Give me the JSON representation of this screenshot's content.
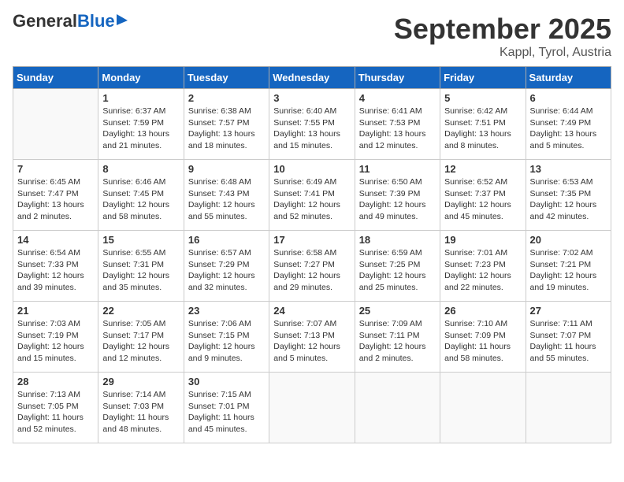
{
  "header": {
    "logo_general": "General",
    "logo_blue": "Blue",
    "month": "September 2025",
    "location": "Kappl, Tyrol, Austria"
  },
  "days_of_week": [
    "Sunday",
    "Monday",
    "Tuesday",
    "Wednesday",
    "Thursday",
    "Friday",
    "Saturday"
  ],
  "weeks": [
    [
      {
        "day": "",
        "sunrise": "",
        "sunset": "",
        "daylight": ""
      },
      {
        "day": "1",
        "sunrise": "Sunrise: 6:37 AM",
        "sunset": "Sunset: 7:59 PM",
        "daylight": "Daylight: 13 hours and 21 minutes."
      },
      {
        "day": "2",
        "sunrise": "Sunrise: 6:38 AM",
        "sunset": "Sunset: 7:57 PM",
        "daylight": "Daylight: 13 hours and 18 minutes."
      },
      {
        "day": "3",
        "sunrise": "Sunrise: 6:40 AM",
        "sunset": "Sunset: 7:55 PM",
        "daylight": "Daylight: 13 hours and 15 minutes."
      },
      {
        "day": "4",
        "sunrise": "Sunrise: 6:41 AM",
        "sunset": "Sunset: 7:53 PM",
        "daylight": "Daylight: 13 hours and 12 minutes."
      },
      {
        "day": "5",
        "sunrise": "Sunrise: 6:42 AM",
        "sunset": "Sunset: 7:51 PM",
        "daylight": "Daylight: 13 hours and 8 minutes."
      },
      {
        "day": "6",
        "sunrise": "Sunrise: 6:44 AM",
        "sunset": "Sunset: 7:49 PM",
        "daylight": "Daylight: 13 hours and 5 minutes."
      }
    ],
    [
      {
        "day": "7",
        "sunrise": "Sunrise: 6:45 AM",
        "sunset": "Sunset: 7:47 PM",
        "daylight": "Daylight: 13 hours and 2 minutes."
      },
      {
        "day": "8",
        "sunrise": "Sunrise: 6:46 AM",
        "sunset": "Sunset: 7:45 PM",
        "daylight": "Daylight: 12 hours and 58 minutes."
      },
      {
        "day": "9",
        "sunrise": "Sunrise: 6:48 AM",
        "sunset": "Sunset: 7:43 PM",
        "daylight": "Daylight: 12 hours and 55 minutes."
      },
      {
        "day": "10",
        "sunrise": "Sunrise: 6:49 AM",
        "sunset": "Sunset: 7:41 PM",
        "daylight": "Daylight: 12 hours and 52 minutes."
      },
      {
        "day": "11",
        "sunrise": "Sunrise: 6:50 AM",
        "sunset": "Sunset: 7:39 PM",
        "daylight": "Daylight: 12 hours and 49 minutes."
      },
      {
        "day": "12",
        "sunrise": "Sunrise: 6:52 AM",
        "sunset": "Sunset: 7:37 PM",
        "daylight": "Daylight: 12 hours and 45 minutes."
      },
      {
        "day": "13",
        "sunrise": "Sunrise: 6:53 AM",
        "sunset": "Sunset: 7:35 PM",
        "daylight": "Daylight: 12 hours and 42 minutes."
      }
    ],
    [
      {
        "day": "14",
        "sunrise": "Sunrise: 6:54 AM",
        "sunset": "Sunset: 7:33 PM",
        "daylight": "Daylight: 12 hours and 39 minutes."
      },
      {
        "day": "15",
        "sunrise": "Sunrise: 6:55 AM",
        "sunset": "Sunset: 7:31 PM",
        "daylight": "Daylight: 12 hours and 35 minutes."
      },
      {
        "day": "16",
        "sunrise": "Sunrise: 6:57 AM",
        "sunset": "Sunset: 7:29 PM",
        "daylight": "Daylight: 12 hours and 32 minutes."
      },
      {
        "day": "17",
        "sunrise": "Sunrise: 6:58 AM",
        "sunset": "Sunset: 7:27 PM",
        "daylight": "Daylight: 12 hours and 29 minutes."
      },
      {
        "day": "18",
        "sunrise": "Sunrise: 6:59 AM",
        "sunset": "Sunset: 7:25 PM",
        "daylight": "Daylight: 12 hours and 25 minutes."
      },
      {
        "day": "19",
        "sunrise": "Sunrise: 7:01 AM",
        "sunset": "Sunset: 7:23 PM",
        "daylight": "Daylight: 12 hours and 22 minutes."
      },
      {
        "day": "20",
        "sunrise": "Sunrise: 7:02 AM",
        "sunset": "Sunset: 7:21 PM",
        "daylight": "Daylight: 12 hours and 19 minutes."
      }
    ],
    [
      {
        "day": "21",
        "sunrise": "Sunrise: 7:03 AM",
        "sunset": "Sunset: 7:19 PM",
        "daylight": "Daylight: 12 hours and 15 minutes."
      },
      {
        "day": "22",
        "sunrise": "Sunrise: 7:05 AM",
        "sunset": "Sunset: 7:17 PM",
        "daylight": "Daylight: 12 hours and 12 minutes."
      },
      {
        "day": "23",
        "sunrise": "Sunrise: 7:06 AM",
        "sunset": "Sunset: 7:15 PM",
        "daylight": "Daylight: 12 hours and 9 minutes."
      },
      {
        "day": "24",
        "sunrise": "Sunrise: 7:07 AM",
        "sunset": "Sunset: 7:13 PM",
        "daylight": "Daylight: 12 hours and 5 minutes."
      },
      {
        "day": "25",
        "sunrise": "Sunrise: 7:09 AM",
        "sunset": "Sunset: 7:11 PM",
        "daylight": "Daylight: 12 hours and 2 minutes."
      },
      {
        "day": "26",
        "sunrise": "Sunrise: 7:10 AM",
        "sunset": "Sunset: 7:09 PM",
        "daylight": "Daylight: 11 hours and 58 minutes."
      },
      {
        "day": "27",
        "sunrise": "Sunrise: 7:11 AM",
        "sunset": "Sunset: 7:07 PM",
        "daylight": "Daylight: 11 hours and 55 minutes."
      }
    ],
    [
      {
        "day": "28",
        "sunrise": "Sunrise: 7:13 AM",
        "sunset": "Sunset: 7:05 PM",
        "daylight": "Daylight: 11 hours and 52 minutes."
      },
      {
        "day": "29",
        "sunrise": "Sunrise: 7:14 AM",
        "sunset": "Sunset: 7:03 PM",
        "daylight": "Daylight: 11 hours and 48 minutes."
      },
      {
        "day": "30",
        "sunrise": "Sunrise: 7:15 AM",
        "sunset": "Sunset: 7:01 PM",
        "daylight": "Daylight: 11 hours and 45 minutes."
      },
      {
        "day": "",
        "sunrise": "",
        "sunset": "",
        "daylight": ""
      },
      {
        "day": "",
        "sunrise": "",
        "sunset": "",
        "daylight": ""
      },
      {
        "day": "",
        "sunrise": "",
        "sunset": "",
        "daylight": ""
      },
      {
        "day": "",
        "sunrise": "",
        "sunset": "",
        "daylight": ""
      }
    ]
  ]
}
